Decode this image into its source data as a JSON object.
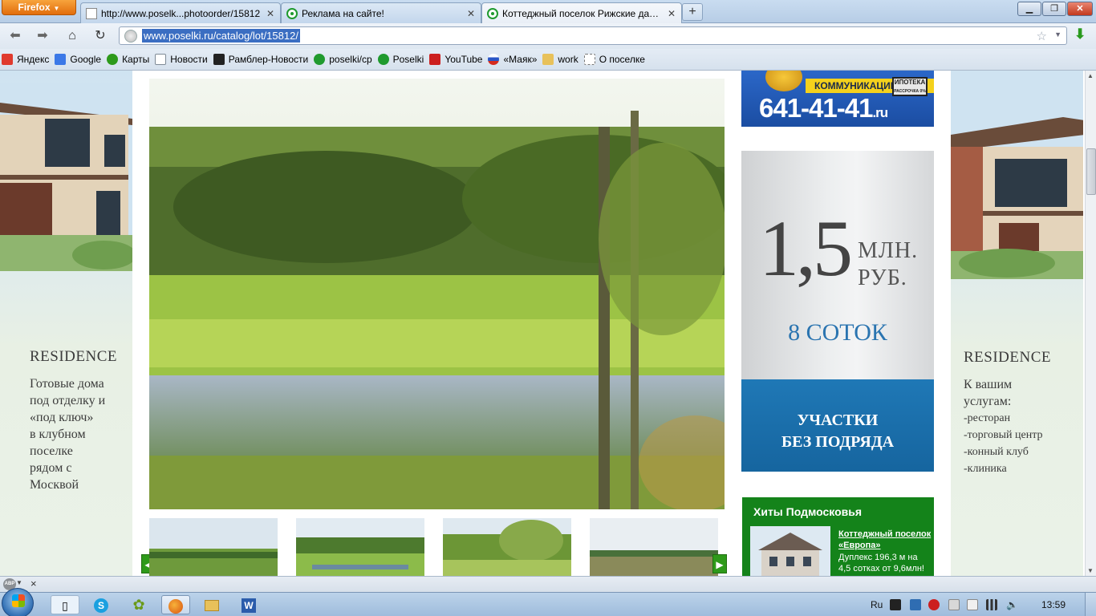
{
  "browser": {
    "app_button": "Firefox",
    "tabs": [
      {
        "label": "http://www.poselk...photoorder/15812",
        "active": false
      },
      {
        "label": "Реклама на сайте!",
        "active": false
      },
      {
        "label": "Коттеджный поселок Рижские дачи...",
        "active": true
      }
    ],
    "new_tab_label": "+",
    "url": "www.poselki.ru/catalog/lot/15812/",
    "bookmarks": [
      {
        "label": "Яндекс",
        "icon": "yandex-icon",
        "color": "#e03a2e"
      },
      {
        "label": "Google",
        "icon": "google-icon",
        "color": "#3b78e7"
      },
      {
        "label": "Карты",
        "icon": "maps-icon",
        "color": "#2e9a1a"
      },
      {
        "label": "Новости",
        "icon": "news-icon",
        "color": "#7e8a96"
      },
      {
        "label": "Рамблер-Новости",
        "icon": "rambler-icon",
        "color": "#222222"
      },
      {
        "label": "poselki/cp",
        "icon": "poselki-icon",
        "color": "#1f9a2e"
      },
      {
        "label": "Poselki",
        "icon": "poselki-icon",
        "color": "#1f9a2e"
      },
      {
        "label": "YouTube",
        "icon": "youtube-icon",
        "color": "#cc1f1f"
      },
      {
        "label": "«Маяк»",
        "icon": "flag-icon",
        "color": "#2a56c6"
      },
      {
        "label": "work",
        "icon": "folder-icon",
        "color": "#e8c15a"
      },
      {
        "label": "О поселке",
        "icon": "page-icon",
        "color": "#ffffff"
      }
    ]
  },
  "page": {
    "left_banner": {
      "brand": "RESIDENCE",
      "lines": [
        "Готовые дома",
        "под отделку и",
        "«под ключ»",
        "в клубном",
        "поселке",
        "рядом с",
        "Москвой"
      ]
    },
    "right_banner": {
      "brand": "RESIDENCE",
      "lines": [
        "К вашим",
        "услугам:",
        "-ресторан",
        "-торговый центр",
        "-конный клуб",
        "-клиника"
      ]
    },
    "ad_top": {
      "band_text": "КОММУНИКАЦИИ",
      "badge_line1": "ИПОТЕКА",
      "badge_line2": "РАССРОЧКА 0%",
      "phone": "641-41-41",
      "phone_suffix": ".ru"
    },
    "ad_mid": {
      "big_number": "1,5",
      "unit_line1": "МЛН.",
      "unit_line2": "РУБ.",
      "size": "8 СОТОК",
      "cta_line1": "УЧАСТКИ",
      "cta_line2": "БЕЗ ПОДРЯДА"
    },
    "hits": {
      "title": "Хиты Подмосковья",
      "link": "Коттеджный поселок «Европа»",
      "text": "Дуплекс 196,3 м на 4,5 сотках от 9,6млн!"
    },
    "gallery": {
      "prev_icon": "chevron-left-icon",
      "next_icon": "chevron-right-icon",
      "prev_label": "◀",
      "next_label": "▶"
    }
  },
  "addon_bar": {
    "abp_label": "ABP",
    "close_label": "×"
  },
  "taskbar": {
    "language": "Ru",
    "time": "13:59"
  }
}
